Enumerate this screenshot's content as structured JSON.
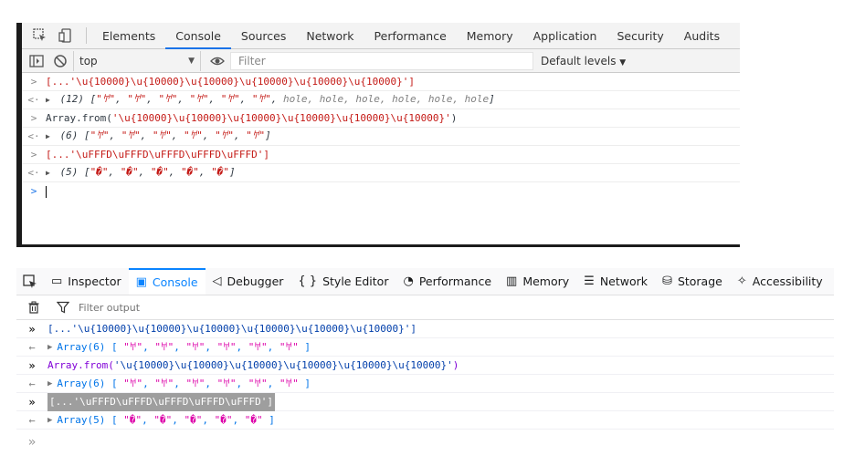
{
  "chrome": {
    "tabs": [
      "Elements",
      "Console",
      "Sources",
      "Network",
      "Performance",
      "Memory",
      "Application",
      "Security",
      "Audits"
    ],
    "active_tab": "Console",
    "context": "top",
    "filter_placeholder": "Filter",
    "levels": "Default levels",
    "rows": [
      {
        "gutter": ">",
        "text": "[...'\\u{10000}\\u{10000}\\u{10000}\\u{10000}\\u{10000}\\u{10000}']"
      },
      {
        "gutter": "<·",
        "count": "(12)",
        "open": "[",
        "items": [
          "\"𐀀\"",
          "\"𐀀\"",
          "\"𐀀\"",
          "\"𐀀\"",
          "\"𐀀\"",
          "\"𐀀\""
        ],
        "holes": "hole, hole, hole, hole, hole, hole",
        "close": "]"
      },
      {
        "gutter": ">",
        "prefix": "Array.from(",
        "text": "'\\u{10000}\\u{10000}\\u{10000}\\u{10000}\\u{10000}\\u{10000}'",
        "suffix": ")"
      },
      {
        "gutter": "<·",
        "count": "(6)",
        "open": "[",
        "items": [
          "\"𐀀\"",
          "\"𐀀\"",
          "\"𐀀\"",
          "\"𐀀\"",
          "\"𐀀\"",
          "\"𐀀\""
        ],
        "close": "]"
      },
      {
        "gutter": ">",
        "text": "[...'\\uFFFD\\uFFFD\\uFFFD\\uFFFD\\uFFFD']"
      },
      {
        "gutter": "<·",
        "count": "(5)",
        "open": "[",
        "items": [
          "\"�\"",
          "\"�\"",
          "\"�\"",
          "\"�\"",
          "\"�\""
        ],
        "close": "]"
      }
    ],
    "prompt": ">"
  },
  "firefox": {
    "tabs": [
      {
        "label": "Inspector",
        "icon": "▭"
      },
      {
        "label": "Console",
        "icon": "▣"
      },
      {
        "label": "Debugger",
        "icon": "◁"
      },
      {
        "label": "Style Editor",
        "icon": "{ }"
      },
      {
        "label": "Performance",
        "icon": "◔"
      },
      {
        "label": "Memory",
        "icon": "▥"
      },
      {
        "label": "Network",
        "icon": "☰"
      },
      {
        "label": "Storage",
        "icon": "⛁"
      },
      {
        "label": "Accessibility",
        "icon": "✧"
      }
    ],
    "active_tab": "Console",
    "filter_placeholder": "Filter output",
    "rows": [
      {
        "gutter": "»",
        "text": "[...'\\u{10000}\\u{10000}\\u{10000}\\u{10000}\\u{10000}\\u{10000}']"
      },
      {
        "gutter": "←",
        "label": "Array(6)",
        "open": "[",
        "items": [
          "\"𐀀\"",
          "\"𐀀\"",
          "\"𐀀\"",
          "\"𐀀\"",
          "\"𐀀\"",
          "\"𐀀\""
        ],
        "close": "]"
      },
      {
        "gutter": "»",
        "fn": "Array.from(",
        "text": "'\\u{10000}\\u{10000}\\u{10000}\\u{10000}\\u{10000}\\u{10000}'",
        "suffix": ")"
      },
      {
        "gutter": "←",
        "label": "Array(6)",
        "open": "[",
        "items": [
          "\"𐀀\"",
          "\"𐀀\"",
          "\"𐀀\"",
          "\"𐀀\"",
          "\"𐀀\"",
          "\"𐀀\""
        ],
        "close": "]"
      },
      {
        "gutter": "»",
        "text": "[...'\\uFFFD\\uFFFD\\uFFFD\\uFFFD\\uFFFD']"
      },
      {
        "gutter": "←",
        "label": "Array(5)",
        "open": "[",
        "items": [
          "\"�\"",
          "\"�\"",
          "\"�\"",
          "\"�\"",
          "\"�\""
        ],
        "close": "]"
      }
    ],
    "prompt": "»"
  }
}
